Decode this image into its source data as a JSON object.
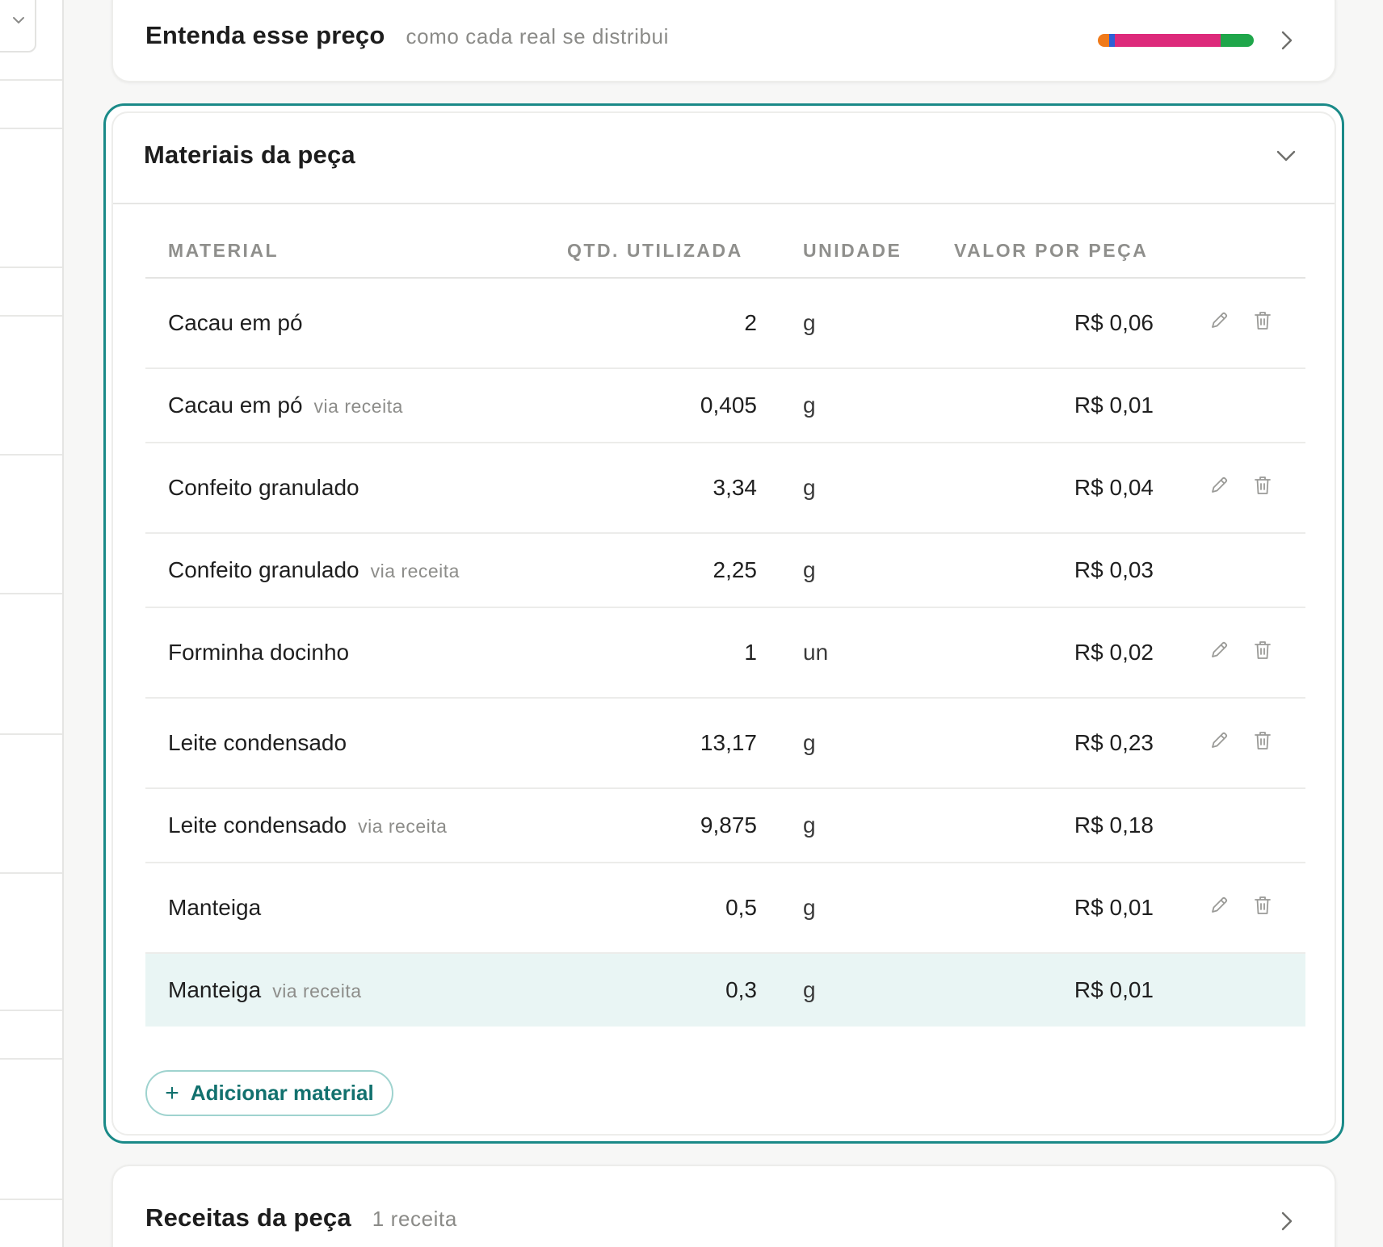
{
  "price_card": {
    "title": "Entenda esse preço",
    "subtitle": "como cada real se distribui",
    "bar_segments": [
      {
        "color": "#f07a1a",
        "fraction": 0.07
      },
      {
        "color": "#2f5fd6",
        "fraction": 0.04
      },
      {
        "color": "#dd2a7b",
        "fraction": 0.68
      },
      {
        "color": "#1fa64a",
        "fraction": 0.21
      }
    ]
  },
  "materials": {
    "title": "Materiais da peça",
    "columns": {
      "material": "MATERIAL",
      "qty": "QTD. UTILIZADA",
      "unit": "UNIDADE",
      "value": "VALOR POR PEÇA"
    },
    "rows": [
      {
        "name": "Cacau em pó",
        "via": "",
        "qty": "2",
        "unit": "g",
        "value": "R$ 0,06",
        "editable": true
      },
      {
        "name": "Cacau em pó",
        "via": "via receita",
        "qty": "0,405",
        "unit": "g",
        "value": "R$ 0,01",
        "editable": false
      },
      {
        "name": "Confeito granulado",
        "via": "",
        "qty": "3,34",
        "unit": "g",
        "value": "R$ 0,04",
        "editable": true
      },
      {
        "name": "Confeito granulado",
        "via": "via receita",
        "qty": "2,25",
        "unit": "g",
        "value": "R$ 0,03",
        "editable": false
      },
      {
        "name": "Forminha docinho",
        "via": "",
        "qty": "1",
        "unit": "un",
        "value": "R$ 0,02",
        "editable": true
      },
      {
        "name": "Leite condensado",
        "via": "",
        "qty": "13,17",
        "unit": "g",
        "value": "R$ 0,23",
        "editable": true
      },
      {
        "name": "Leite condensado",
        "via": "via receita",
        "qty": "9,875",
        "unit": "g",
        "value": "R$ 0,18",
        "editable": false
      },
      {
        "name": "Manteiga",
        "via": "",
        "qty": "0,5",
        "unit": "g",
        "value": "R$ 0,01",
        "editable": true
      },
      {
        "name": "Manteiga",
        "via": "via receita",
        "qty": "0,3",
        "unit": "g",
        "value": "R$ 0,01",
        "editable": false
      }
    ],
    "add_button_label": "Adicionar material",
    "add_button_icon": "+"
  },
  "recipes_card": {
    "title": "Receitas da peça",
    "subtitle": "1 receita"
  },
  "colors": {
    "accent": "#1a8a88",
    "accent_text": "#12716e",
    "highlight_row": "#e9f5f4"
  }
}
